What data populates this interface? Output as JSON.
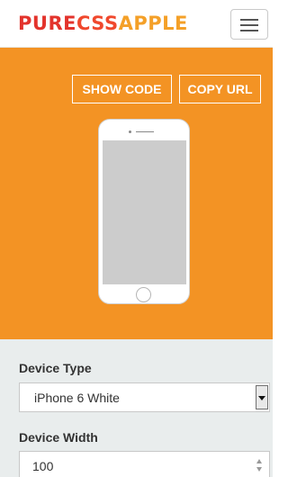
{
  "header": {
    "logo": {
      "part1": "PURE",
      "part2": "CSS",
      "part3": "APPLE"
    },
    "menu_icon": "hamburger-menu-icon"
  },
  "hero": {
    "show_code_label": "SHOW CODE",
    "copy_url_label": "COPY URL",
    "background_color": "#f39324"
  },
  "form": {
    "device_type": {
      "label": "Device Type",
      "value": "iPhone 6 White"
    },
    "device_width": {
      "label": "Device Width",
      "value": "100"
    }
  },
  "colors": {
    "logo_red": "#e3332c",
    "logo_orange": "#f4a028",
    "accent_orange": "#f39324"
  }
}
